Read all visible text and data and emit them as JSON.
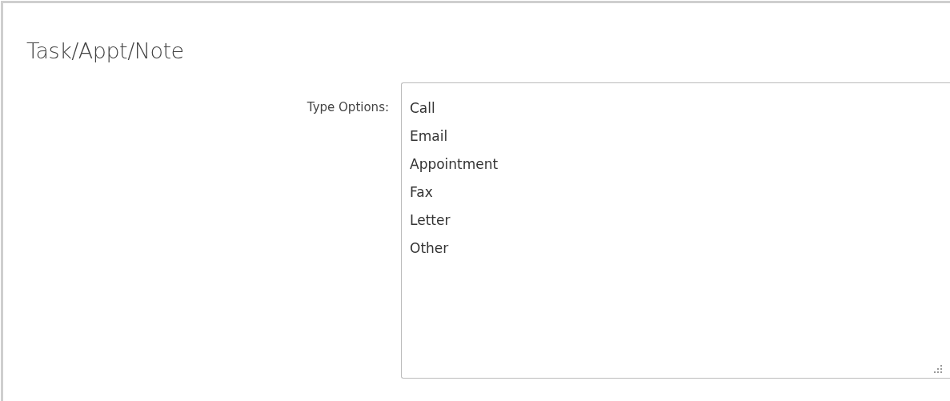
{
  "section": {
    "title": "Task/Appt/Note"
  },
  "type_options": {
    "label": "Type Options:",
    "options": [
      "Call",
      "Email",
      "Appointment",
      "Fax",
      "Letter",
      "Other"
    ]
  }
}
